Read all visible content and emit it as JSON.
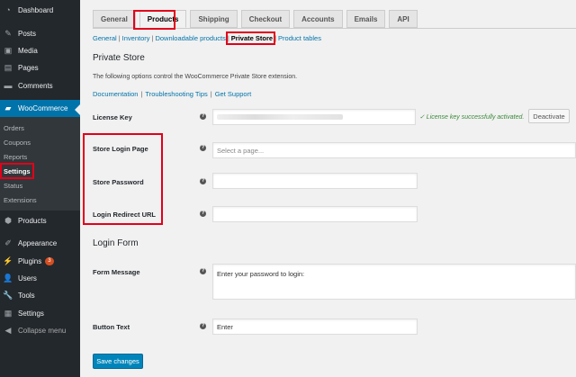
{
  "sidebar": {
    "items": [
      {
        "label": "Dashboard",
        "icon": "dashboard-icon",
        "glyph": "◔"
      },
      {
        "label": "Posts",
        "icon": "pin-icon",
        "glyph": "✎"
      },
      {
        "label": "Media",
        "icon": "media-icon",
        "glyph": "▣"
      },
      {
        "label": "Pages",
        "icon": "pages-icon",
        "glyph": "▤"
      },
      {
        "label": "Comments",
        "icon": "comments-icon",
        "glyph": "▬"
      },
      {
        "label": "WooCommerce",
        "icon": "woocommerce-icon",
        "glyph": "▰"
      },
      {
        "label": "Products",
        "icon": "products-icon",
        "glyph": "⬢"
      },
      {
        "label": "Appearance",
        "icon": "appearance-icon",
        "glyph": "✐"
      },
      {
        "label": "Plugins",
        "icon": "plugins-icon",
        "glyph": "⚡",
        "badge": "3"
      },
      {
        "label": "Users",
        "icon": "users-icon",
        "glyph": "👤"
      },
      {
        "label": "Tools",
        "icon": "tools-icon",
        "glyph": "🔧"
      },
      {
        "label": "Settings",
        "icon": "settings-icon",
        "glyph": "▦"
      },
      {
        "label": "Collapse menu",
        "icon": "collapse-icon",
        "glyph": "◀"
      }
    ],
    "woo_submenu": [
      "Orders",
      "Coupons",
      "Reports",
      "Settings",
      "Status",
      "Extensions"
    ]
  },
  "tabs": [
    "General",
    "Products",
    "Shipping",
    "Checkout",
    "Accounts",
    "Emails",
    "API"
  ],
  "subnav": [
    "General",
    "Inventory",
    "Downloadable products",
    "Private Store",
    "Product tables"
  ],
  "section1": {
    "title": "Private Store",
    "description": "The following options control the WooCommerce Private Store extension.",
    "links": [
      "Documentation",
      "Troubleshooting Tips",
      "Get Support"
    ]
  },
  "fields": {
    "license": {
      "label": "License Key",
      "valid_text": "✓ License key successfully activated.",
      "button": "Deactivate"
    },
    "store_login_page": {
      "label": "Store Login Page",
      "placeholder": "Select a page..."
    },
    "store_password": {
      "label": "Store Password",
      "value": ""
    },
    "login_redirect": {
      "label": "Login Redirect URL",
      "value": ""
    }
  },
  "section2": {
    "title": "Login Form"
  },
  "form_message": {
    "label": "Form Message",
    "value": "Enter your password to login:"
  },
  "button_text": {
    "label": "Button Text",
    "value": "Enter"
  },
  "save_button": "Save changes",
  "colors": {
    "sidebar": "#23282d",
    "accent": "#0073aa",
    "highlight": "#e2001a",
    "primary_button": "#0085ba"
  }
}
